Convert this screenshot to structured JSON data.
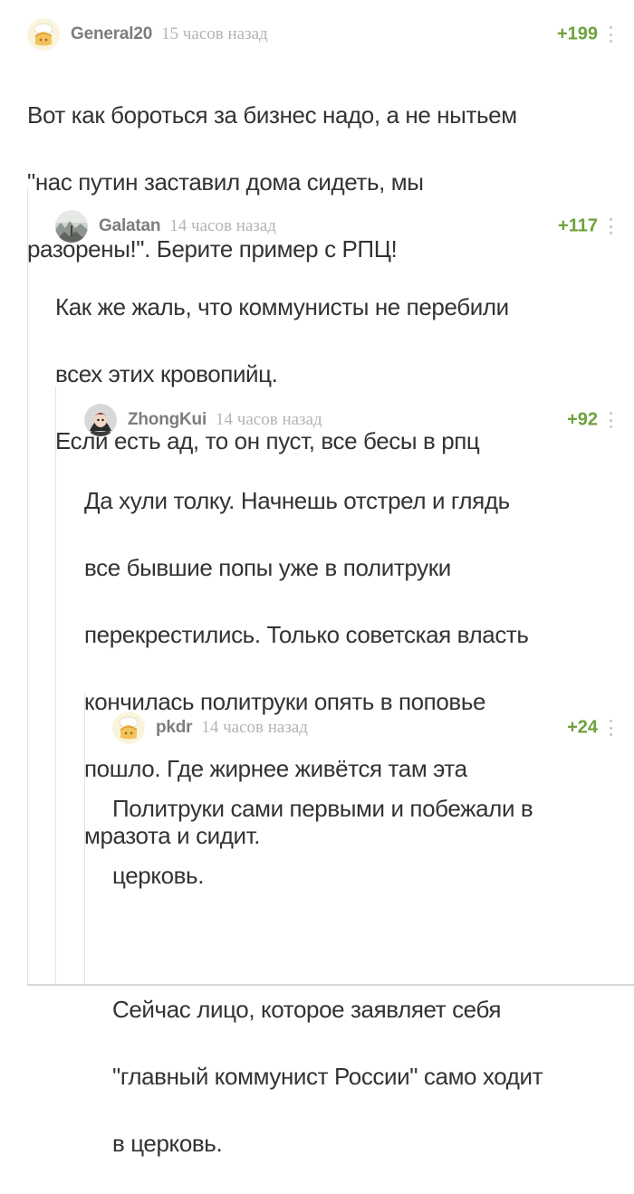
{
  "comments": [
    {
      "author": "General20",
      "time": "15 часов назад",
      "rating": "+199",
      "avatar": "default-dough-avatar",
      "text": [
        "Вот как бороться за бизнес надо, а не нытьем",
        "\"нас путин заставил дома сидеть, мы",
        "разорены!\". Берите пример с РПЦ!"
      ]
    },
    {
      "author": "Galatan",
      "time": "14 часов назад",
      "rating": "+117",
      "avatar": "photo-avatar",
      "text": [
        "Как же жаль, что коммунисты не перебили",
        "всех этих кровопийц.",
        "Если есть ад, то он пуст, все бесы в рпц"
      ]
    },
    {
      "author": "ZhongKui",
      "time": "14 часов назад",
      "rating": "+92",
      "avatar": "character-avatar",
      "text": [
        "Да хули толку. Начнешь отстрел и глядь",
        "все бывшие попы уже в политруки",
        "перекрестились. Только советская власть",
        "кончилась политруки опять в поповье",
        "пошло. Где жирнее живётся там эта",
        "мразота и сидит."
      ]
    },
    {
      "author": "pkdr",
      "time": "14 часов назад",
      "rating": "+24",
      "avatar": "default-dough-avatar",
      "text_a": [
        "Политруки сами первыми и побежали в",
        "церковь."
      ],
      "text_b": [
        "Сейчас лицо, которое заявляет себя",
        "\"главный коммунист России\" само ходит",
        "в церковь."
      ]
    }
  ],
  "colors": {
    "rating": "#6ea13c",
    "author": "#7d7d7d",
    "time": "#b4b4b4",
    "text": "#333333",
    "thread_line": "#e4e4e4"
  }
}
